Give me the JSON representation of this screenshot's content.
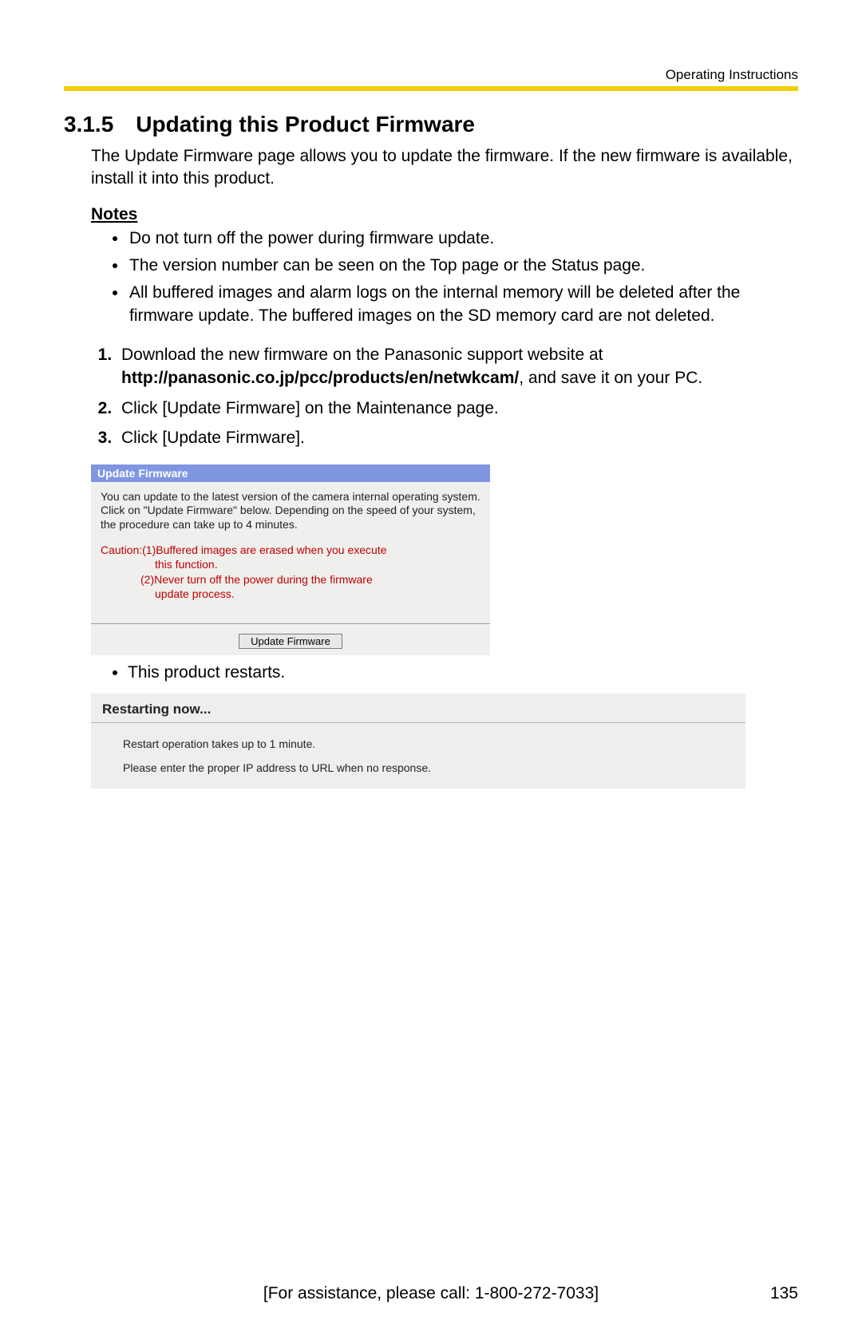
{
  "header": {
    "doc_title": "Operating Instructions"
  },
  "section": {
    "number": "3.1.5",
    "title": "Updating this Product Firmware",
    "intro": "The Update Firmware page allows you to update the firmware. If the new firmware is available, install it into this product."
  },
  "notes": {
    "heading": "Notes",
    "items": [
      "Do not turn off the power during firmware update.",
      "The version number can be seen on the Top page or the Status page.",
      "All buffered images and alarm logs on the internal memory will be deleted after the firmware update. The buffered images on the SD memory card are not deleted."
    ]
  },
  "steps": {
    "s1_pre": "Download the new firmware on the Panasonic support website at ",
    "s1_bold": "http://panasonic.co.jp/pcc/products/en/netwkcam/",
    "s1_post": ", and save it on your PC.",
    "s2": "Click [Update Firmware] on the Maintenance page.",
    "s3": "Click [Update Firmware]."
  },
  "panel": {
    "titlebar": "Update Firmware",
    "body": "You can update to the latest version of the camera internal operating system.\nClick on \"Update Firmware\" below. Depending on the speed of your system, the procedure can take up to 4 minutes.",
    "caution_lead": "Caution:(1)Buffered images are erased when you execute",
    "caution_l2": "this function.",
    "caution_l3": "(2)Never turn off the power during the firmware",
    "caution_l4": "update process.",
    "button": "Update  Firmware"
  },
  "sub_bullet": "This product restarts.",
  "restart": {
    "title": "Restarting now...",
    "line1": "Restart operation takes up to 1 minute.",
    "line2": "Please enter the proper IP address to URL when no response."
  },
  "footer": {
    "assist": "[For assistance, please call: 1-800-272-7033]",
    "page_no": "135"
  }
}
